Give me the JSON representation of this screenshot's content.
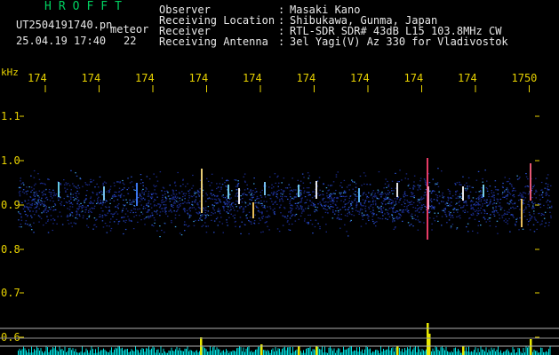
{
  "header": {
    "brand": "HROFFT",
    "filename": "UT2504191740.pn",
    "mode": "meteor",
    "datetime": "25.04.19 17:40",
    "count": "22",
    "fields": [
      {
        "label": "Observer",
        "value": "Masaki Kano"
      },
      {
        "label": "Receiving Location",
        "value": "Shibukawa, Gunma, Japan"
      },
      {
        "label": "Receiver",
        "value": "RTL-SDR SDR# 43dB L15 103.8MHz CW"
      },
      {
        "label": "Receiving Antenna",
        "value": "3el Yagi(V) Az 330 for Vladivostok"
      }
    ]
  },
  "chart_data": {
    "type": "heatmap",
    "ylabel": "kHz",
    "y_ticks": [
      "1.1",
      "1.0",
      "0.9",
      "0.8",
      "0.7",
      "0.6"
    ],
    "x_ticks": [
      "174",
      "174",
      "174",
      "174",
      "174",
      "174",
      "174",
      "174",
      "174",
      "1750"
    ],
    "colors": {
      "axis_text": "#e8d200",
      "background": "#000000",
      "signal_low": "#2040c0",
      "signal_high": "#ff3060",
      "meter": "#00e0e0",
      "meteor_mark": "#e8e800"
    }
  }
}
